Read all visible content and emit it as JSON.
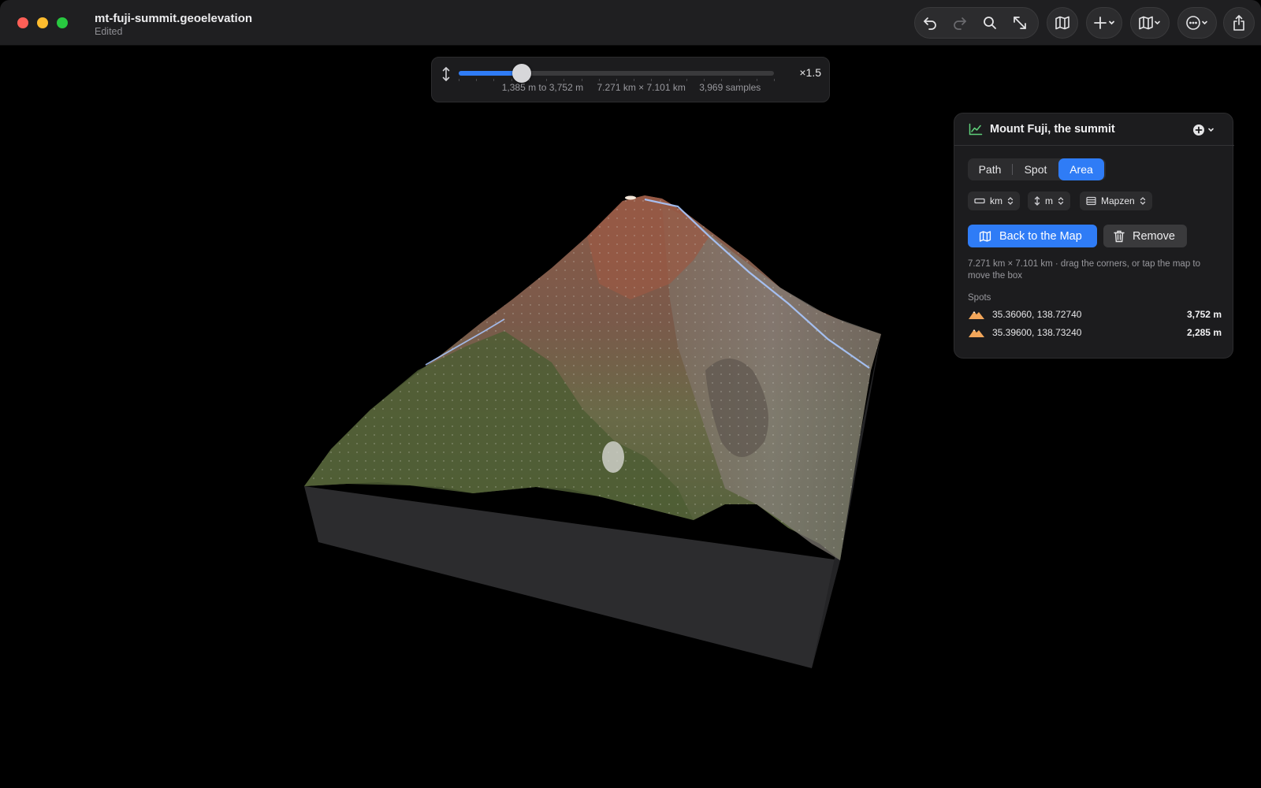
{
  "window": {
    "title": "mt-fuji-summit.geoelevation",
    "subtitle": "Edited"
  },
  "toolbar": {
    "icons": [
      "undo-icon",
      "redo-icon",
      "search-icon",
      "resize-icon",
      "map-icon",
      "plus-icon",
      "map-style-icon",
      "more-icon",
      "share-icon"
    ]
  },
  "exaggeration": {
    "fraction": 0.2,
    "value_label": "×1.5",
    "range": "1,385 m to 3,752 m",
    "extent": "7.271 km × 7.101 km",
    "samples": "3,969 samples"
  },
  "panel": {
    "title": "Mount Fuji, the summit",
    "tabs": [
      {
        "label": "Path",
        "active": false
      },
      {
        "label": "Spot",
        "active": false
      },
      {
        "label": "Area",
        "active": true
      }
    ],
    "units": {
      "distance": "km",
      "elevation": "m",
      "source": "Mapzen"
    },
    "back_button": "Back to the Map",
    "remove_button": "Remove",
    "hint": "7.271 km × 7.101 km · drag the corners, or tap the map to move the box",
    "spots_label": "Spots",
    "spots": [
      {
        "coords": "35.36060, 138.72740",
        "elevation": "3,752 m"
      },
      {
        "coords": "35.39600, 138.73240",
        "elevation": "2,285 m"
      }
    ]
  },
  "colors": {
    "accent": "#2f7cf6",
    "background": "#000000",
    "panel": "#1c1c1e",
    "spot_icon": "#f2a65a"
  }
}
